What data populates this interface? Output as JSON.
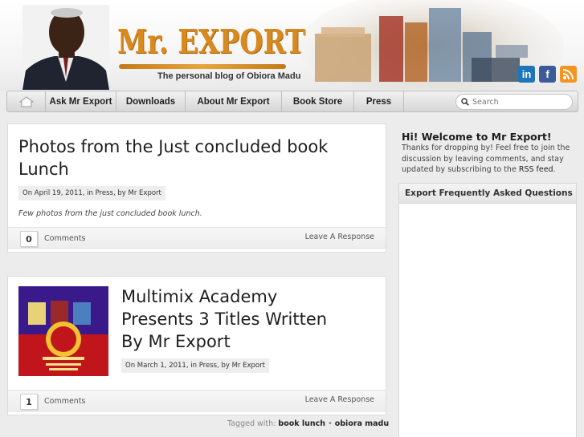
{
  "header": {
    "logo_text": "Mr. EXPORT",
    "tagline": "The personal blog of Obiora Madu",
    "social": [
      {
        "icon": "linkedin-icon",
        "glyph": "in",
        "color": "#1c76b8"
      },
      {
        "icon": "facebook-icon",
        "glyph": "f",
        "color": "#3b5b9a"
      },
      {
        "icon": "rss-icon",
        "glyph": "",
        "color": "#f39420"
      }
    ]
  },
  "nav": {
    "home_icon": "home-icon",
    "items": [
      {
        "label": "Ask Mr Export"
      },
      {
        "label": "Downloads"
      },
      {
        "label": "About Mr Export"
      },
      {
        "label": "Book Store"
      },
      {
        "label": "Press"
      }
    ],
    "search_placeholder": "Search"
  },
  "posts": [
    {
      "title": "Photos from the Just concluded book Lunch",
      "meta": "On April 19, 2011, in Press, by Mr Export",
      "excerpt": "Few photos from the just concluded book lunch.",
      "comment_count": "0",
      "comments_label": "Comments",
      "leave_label": "Leave A Response"
    },
    {
      "title": "Multimix Academy Presents 3 Titles Written By Mr Export",
      "meta": "On March 1, 2011, in Press, by Mr Export",
      "comment_count": "1",
      "comments_label": "Comments",
      "leave_label": "Leave A Response"
    }
  ],
  "tags": {
    "label": "Tagged with:",
    "items": [
      "book lunch",
      "obiora madu"
    ],
    "separator": "•"
  },
  "sidebar": {
    "welcome_title": "Hi! Welcome to Mr Export!",
    "welcome_text": "Thanks for dropping by! Feel free to join the discussion by leaving comments, and stay updated by subscribing to the",
    "rss_link": "RSS feed",
    "welcome_end": ".",
    "faq_title": "Export Frequently Asked Questions"
  },
  "colors": {
    "logo": "#d98a1e",
    "background": "#ececec",
    "nav": "#e4e4e4"
  }
}
